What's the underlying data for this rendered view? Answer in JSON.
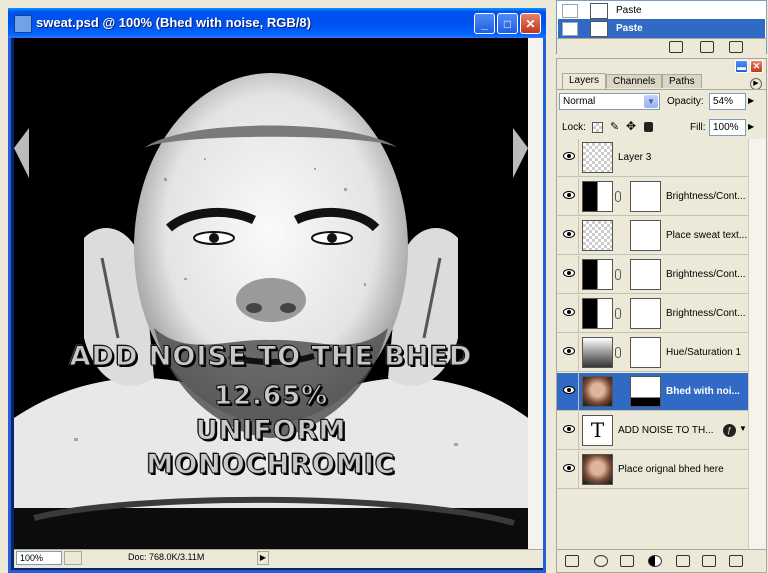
{
  "document_window": {
    "title": "sweat.psd @ 100% (Bhed with noise, RGB/8)",
    "controls": {
      "minimize": "_",
      "maximize": "□",
      "close": "✕"
    },
    "canvas_text": [
      "ADD NOISE TO THE BHED",
      "12.65%",
      "UNIFORM",
      "MONOCHROMIC"
    ],
    "status": {
      "zoom": "100%",
      "doc_size": "Doc: 768.0K/3.11M"
    }
  },
  "history": {
    "items": [
      {
        "label": "Paste",
        "selected": false
      },
      {
        "label": "Paste",
        "selected": true
      }
    ]
  },
  "layers_panel": {
    "tabs": [
      "Layers",
      "Channels",
      "Paths"
    ],
    "active_tab": "Layers",
    "blend_mode": "Normal",
    "opacity_label": "Opacity:",
    "opacity": "54%",
    "lock_label": "Lock:",
    "fill_label": "Fill:",
    "fill": "100%",
    "layers": [
      {
        "name": "Layer 3",
        "kind": "pixel",
        "selected": false
      },
      {
        "name": "Brightness/Cont...",
        "kind": "adjustment",
        "selected": false
      },
      {
        "name": "Place sweat text...",
        "kind": "pixel-mask",
        "selected": false
      },
      {
        "name": "Brightness/Cont...",
        "kind": "adjustment",
        "selected": false
      },
      {
        "name": "Brightness/Cont...",
        "kind": "adjustment",
        "selected": false
      },
      {
        "name": "Hue/Saturation 1",
        "kind": "adjustment",
        "selected": false
      },
      {
        "name": "Bhed with noi...",
        "kind": "photo-mask",
        "selected": true
      },
      {
        "name": "ADD NOISE TO TH...",
        "kind": "text",
        "text_icon": "T",
        "selected": false
      },
      {
        "name": "Place orignal bhed here",
        "kind": "photo",
        "selected": false
      }
    ]
  },
  "colors": {
    "titlebar": "#0053ee",
    "selection": "#316ac5",
    "panel_bg": "#ece9d8"
  }
}
